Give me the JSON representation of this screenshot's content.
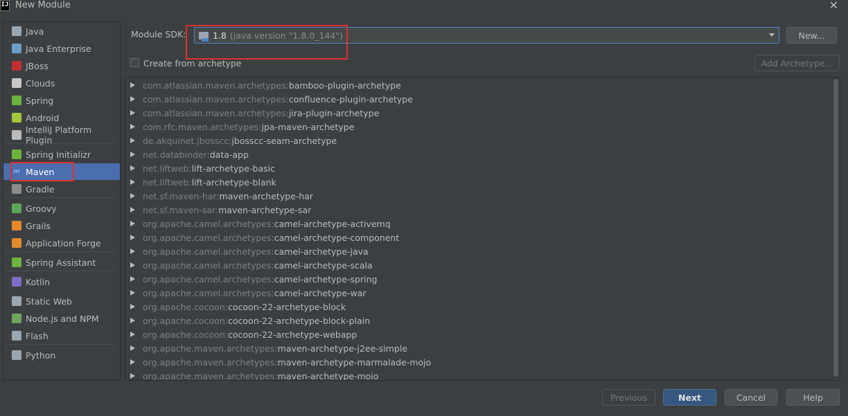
{
  "window": {
    "title": "New Module",
    "icon_text": "IJ"
  },
  "sidebar": {
    "items": [
      {
        "label": "Java",
        "icon": "folder-icon",
        "color": "#9aa7b0"
      },
      {
        "label": "Java Enterprise",
        "icon": "java-ee-icon",
        "color": "#6aa0c8"
      },
      {
        "label": "JBoss",
        "icon": "jboss-icon",
        "color": "#c03030"
      },
      {
        "label": "Clouds",
        "icon": "cloud-icon",
        "color": "#c8c8c8"
      },
      {
        "label": "Spring",
        "icon": "spring-leaf-icon",
        "color": "#6db33f"
      },
      {
        "label": "Android",
        "icon": "android-icon",
        "color": "#a4c639"
      },
      {
        "label": "IntelliJ Platform Plugin",
        "icon": "plugin-icon",
        "color": "#bbbbbb"
      },
      {
        "label": "Spring Initializr",
        "icon": "spring-initializr-icon",
        "color": "#6db33f"
      },
      {
        "label": "Maven",
        "icon": "maven-icon",
        "color": "#4b6eaf"
      },
      {
        "label": "Gradle",
        "icon": "gradle-elephant-icon",
        "color": "#8c8c8c"
      },
      {
        "label": "Groovy",
        "icon": "groovy-icon",
        "color": "#5ba65b"
      },
      {
        "label": "Grails",
        "icon": "grails-icon",
        "color": "#e28a2b"
      },
      {
        "label": "Application Forge",
        "icon": "forge-icon",
        "color": "#e28a2b"
      },
      {
        "label": "Spring Assistant",
        "icon": "power-icon",
        "color": "#6db33f"
      },
      {
        "label": "Kotlin",
        "icon": "kotlin-icon",
        "color": "#7f6dc6"
      },
      {
        "label": "Static Web",
        "icon": "globe-icon",
        "color": "#9aa7b0"
      },
      {
        "label": "Node.js and NPM",
        "icon": "nodejs-icon",
        "color": "#6da55f"
      },
      {
        "label": "Flash",
        "icon": "flash-icon",
        "color": "#9aa7b0"
      },
      {
        "label": "Python",
        "icon": "python-icon",
        "color": "#9aa7b0"
      }
    ]
  },
  "sdk": {
    "label": "Module SDK:",
    "version": "1.8",
    "detail": "(java version \"1.8.0_144\")",
    "new_button": "New..."
  },
  "archetype": {
    "checkbox_label": "Create from archetype",
    "add_button": "Add Archetype..."
  },
  "archetypes": [
    {
      "group": "com.atlassian.maven.archetypes:",
      "artifact": "bamboo-plugin-archetype"
    },
    {
      "group": "com.atlassian.maven.archetypes:",
      "artifact": "confluence-plugin-archetype"
    },
    {
      "group": "com.atlassian.maven.archetypes:",
      "artifact": "jira-plugin-archetype"
    },
    {
      "group": "com.rfc.maven.archetypes:",
      "artifact": "jpa-maven-archetype"
    },
    {
      "group": "de.akquinet.jbosscc:",
      "artifact": "jbosscc-seam-archetype"
    },
    {
      "group": "net.databinder:",
      "artifact": "data-app"
    },
    {
      "group": "net.liftweb:",
      "artifact": "lift-archetype-basic"
    },
    {
      "group": "net.liftweb:",
      "artifact": "lift-archetype-blank"
    },
    {
      "group": "net.sf.maven-har:",
      "artifact": "maven-archetype-har"
    },
    {
      "group": "net.sf.maven-sar:",
      "artifact": "maven-archetype-sar"
    },
    {
      "group": "org.apache.camel.archetypes:",
      "artifact": "camel-archetype-activemq"
    },
    {
      "group": "org.apache.camel.archetypes:",
      "artifact": "camel-archetype-component"
    },
    {
      "group": "org.apache.camel.archetypes:",
      "artifact": "camel-archetype-java"
    },
    {
      "group": "org.apache.camel.archetypes:",
      "artifact": "camel-archetype-scala"
    },
    {
      "group": "org.apache.camel.archetypes:",
      "artifact": "camel-archetype-spring"
    },
    {
      "group": "org.apache.camel.archetypes:",
      "artifact": "camel-archetype-war"
    },
    {
      "group": "org.apache.cocoon:",
      "artifact": "cocoon-22-archetype-block"
    },
    {
      "group": "org.apache.cocoon:",
      "artifact": "cocoon-22-archetype-block-plain"
    },
    {
      "group": "org.apache.cocoon:",
      "artifact": "cocoon-22-archetype-webapp"
    },
    {
      "group": "org.apache.maven.archetypes:",
      "artifact": "maven-archetype-j2ee-simple"
    },
    {
      "group": "org.apache.maven.archetypes:",
      "artifact": "maven-archetype-marmalade-mojo"
    },
    {
      "group": "org.apache.maven.archetypes:",
      "artifact": "maven-archetype-mojo"
    }
  ],
  "footer": {
    "previous": "Previous",
    "next": "Next",
    "cancel": "Cancel",
    "help": "Help"
  }
}
